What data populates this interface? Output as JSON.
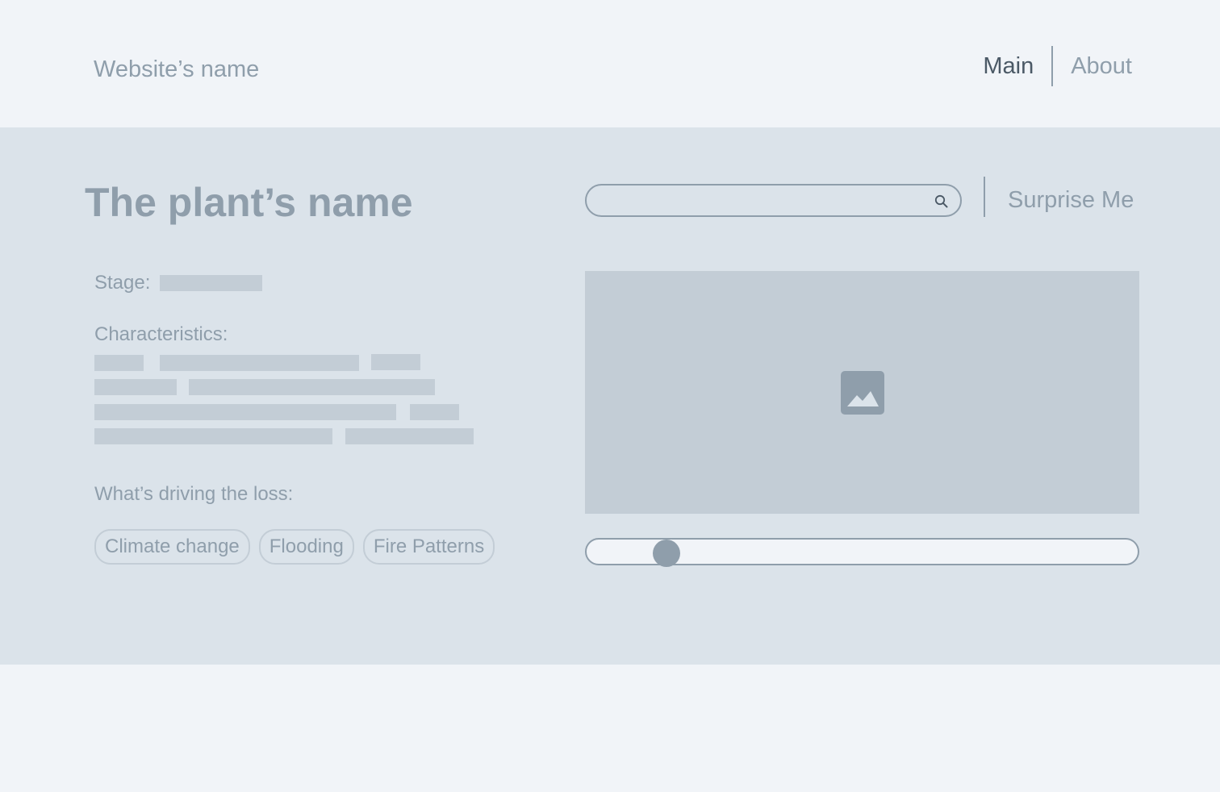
{
  "header": {
    "site_name": "Website’s name",
    "nav": [
      {
        "label": "Main",
        "active": true
      },
      {
        "label": "About",
        "active": false
      }
    ]
  },
  "plant": {
    "title": "The plant’s name",
    "stage_label": "Stage:",
    "characteristics_label": "Characteristics:",
    "loss_label": "What’s driving the loss:",
    "loss_tags": [
      "Climate change",
      "Flooding",
      "Fire Patterns"
    ]
  },
  "search": {
    "placeholder": "",
    "value": "",
    "icon": "search-icon",
    "surprise_label": "Surprise Me"
  },
  "media": {
    "image_icon": "image-icon",
    "slider_value": 0.145
  },
  "colors": {
    "page_bg": "#f1f4f8",
    "band_bg": "#dbe3ea",
    "placeholder": "#c3cdd6",
    "muted_text": "#8f9eab",
    "active_text": "#4b5966"
  }
}
